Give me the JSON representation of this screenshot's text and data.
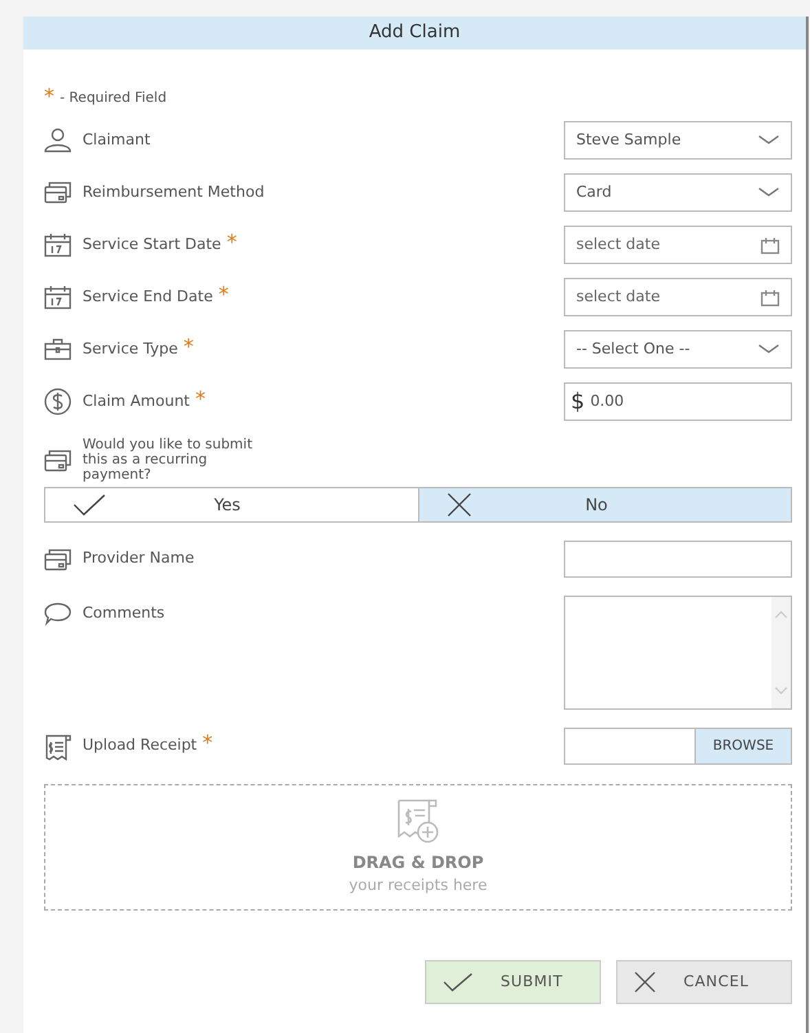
{
  "dialog": {
    "title": "Add Claim"
  },
  "required_note": {
    "mark": "*",
    "text": "- Required Field"
  },
  "fields": [
    {
      "kind": "select",
      "label": "Claimant",
      "required": false,
      "value": "Steve Sample"
    },
    {
      "kind": "select",
      "label": "Reimbursement Method",
      "required": false,
      "value": "Card"
    },
    {
      "kind": "date",
      "label": "Service Start Date",
      "required": true,
      "placeholder": "select date"
    },
    {
      "kind": "date",
      "label": "Service End Date",
      "required": true,
      "placeholder": "select date"
    },
    {
      "kind": "select",
      "label": "Service Type",
      "required": true,
      "value": "-- Select One --"
    },
    {
      "kind": "amount",
      "label": "Claim Amount",
      "required": true,
      "currency": "$",
      "value": "0.00"
    }
  ],
  "recurring": {
    "question": "Would you like to submit this as a recurring payment?",
    "options": [
      {
        "label": "Yes",
        "kind": "yes",
        "selected": false
      },
      {
        "label": "No",
        "kind": "no",
        "selected": true
      }
    ]
  },
  "provider": {
    "label": "Provider Name",
    "required": false
  },
  "comments": {
    "label": "Comments",
    "required": false
  },
  "upload": {
    "label": "Upload Receipt",
    "required": true,
    "button": "BROWSE"
  },
  "dropzone": {
    "title": "DRAG & DROP",
    "subtitle": "your receipts here"
  },
  "actions": [
    {
      "label": "SUBMIT",
      "kind": "submit"
    },
    {
      "label": "CANCEL",
      "kind": "cancel"
    }
  ]
}
